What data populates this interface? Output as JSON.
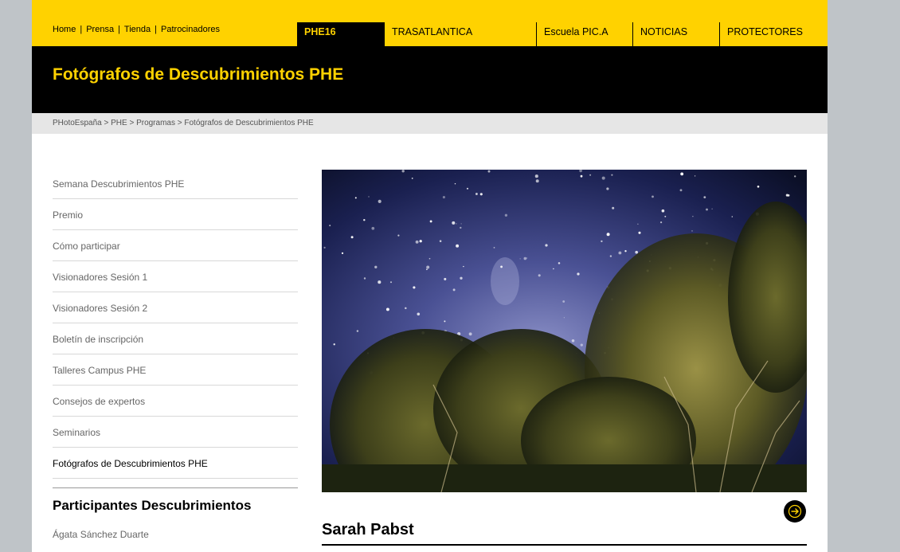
{
  "utility_nav": {
    "items": [
      "Home",
      "Prensa",
      "Tienda",
      "Patrocinadores"
    ],
    "separator": "|"
  },
  "main_nav": {
    "items": [
      "PHE16",
      "TRASATLANTICA",
      "Escuela PIC.A",
      "NOTICIAS",
      "PROTECTORES"
    ],
    "active": "PHE16"
  },
  "page_title": "Fotógrafos de Descubrimientos PHE",
  "breadcrumb": "PHotoEspaña > PHE > Programas > Fotógrafos de Descubrimientos PHE",
  "sidebar": {
    "items": [
      "Semana Descubrimientos PHE",
      "Premio",
      "Cómo participar",
      "Visionadores Sesión 1",
      "Visionadores Sesión 2",
      "Boletín de inscripción",
      "Talleres Campus PHE",
      "Consejos de expertos",
      "Seminarios",
      "Fotógrafos de Descubrimientos PHE"
    ],
    "current": "Fotógrafos de Descubrimientos PHE",
    "participants_heading": "Participantes Descubrimientos",
    "participants": [
      "Ágata Sánchez Duarte"
    ]
  },
  "gallery": {
    "photo_alt": "Night sky with stars above trees",
    "artist": "Sarah Pabst",
    "next_icon": "arrow-right-icon"
  },
  "colors": {
    "brand_yellow": "#ffd200",
    "black": "#000000",
    "breadcrumb_bg": "#e6e6e6",
    "background": "#bfc4c8"
  }
}
